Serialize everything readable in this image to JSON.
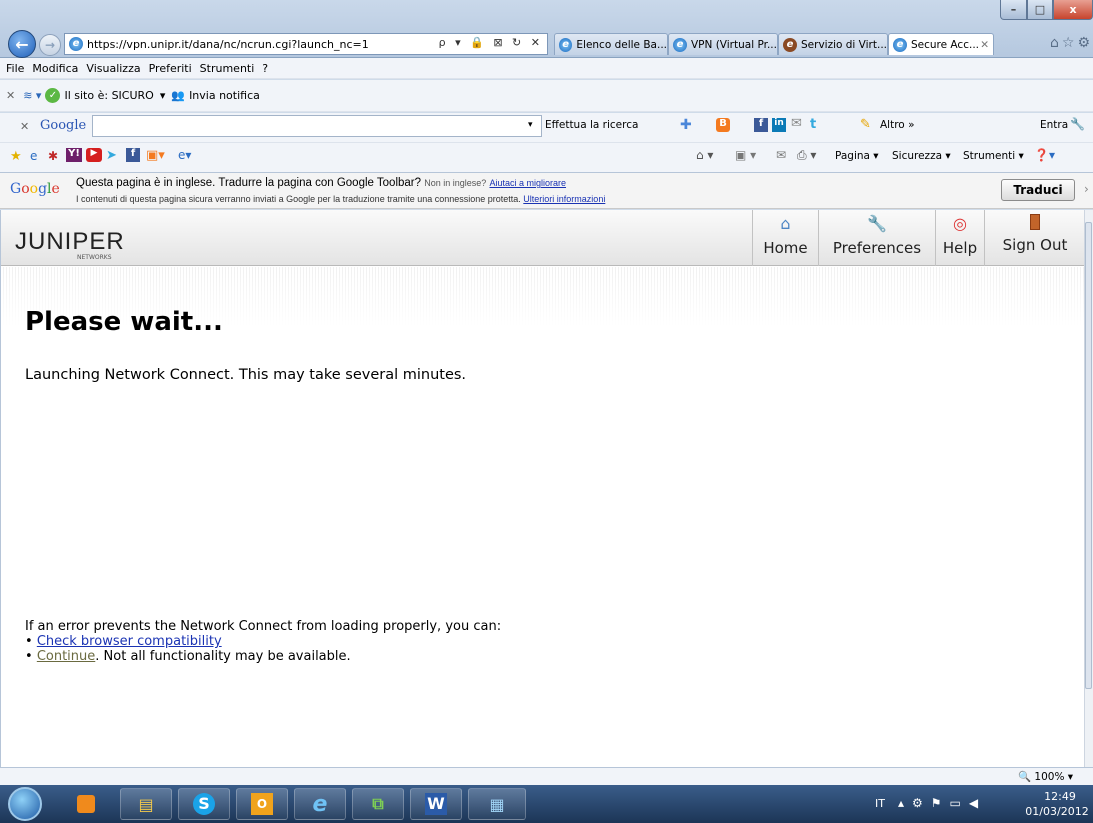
{
  "window": {
    "close": "x"
  },
  "address": {
    "url": "https://vpn.unipr.it/dana/nc/ncrun.cgi?launch_nc=1",
    "tools": "ρ ▾ 🔒 ⊠ ↻ ✕"
  },
  "tabs": [
    {
      "label": "Elenco delle Ba..."
    },
    {
      "label": "VPN (Virtual Pr..."
    },
    {
      "label": "Servizio di Virt..."
    },
    {
      "label": "Secure Acc...",
      "active": true
    }
  ],
  "menu": [
    "File",
    "Modifica",
    "Visualizza",
    "Preferiti",
    "Strumenti",
    "?"
  ],
  "cmdbar": {
    "site_status": "Il sito è: SICURO",
    "notify": "Invia notifica"
  },
  "googlebar": {
    "brand": "Google",
    "search_btn": "Effettua la ricerca",
    "altro": "Altro »",
    "entra": "Entra"
  },
  "favbar": {
    "pagina": "Pagina ▾",
    "sicurezza": "Sicurezza ▾",
    "strumenti": "Strumenti ▾"
  },
  "translate": {
    "brand": "Google",
    "message": "Questa pagina è in inglese. Tradurre la pagina con Google Toolbar?",
    "not_english": "Non in inglese?",
    "help_link": "Aiutaci a migliorare",
    "sub": "I contenuti di questa pagina sicura verranno inviati a Google per la traduzione tramite una connessione protetta.",
    "more_link": "Ulteriori informazioni",
    "button": "Traduci"
  },
  "juniper": {
    "logo": "JUNIPER",
    "logo_sub": "NETWORKS",
    "nav": [
      "Home",
      "Preferences",
      "Help",
      "Sign Out"
    ],
    "heading": "Please wait...",
    "launching": "Launching Network Connect. This may take several minutes.",
    "error_intro": "If an error prevents the Network Connect from loading properly, you can:",
    "check_link": "Check browser compatibility",
    "continue_link": "Continue",
    "continue_rest": ". Not all functionality may be available."
  },
  "status": {
    "zoom": "100%"
  },
  "taskbar": {
    "lang": "IT",
    "time": "12:49",
    "date": "01/03/2012"
  }
}
